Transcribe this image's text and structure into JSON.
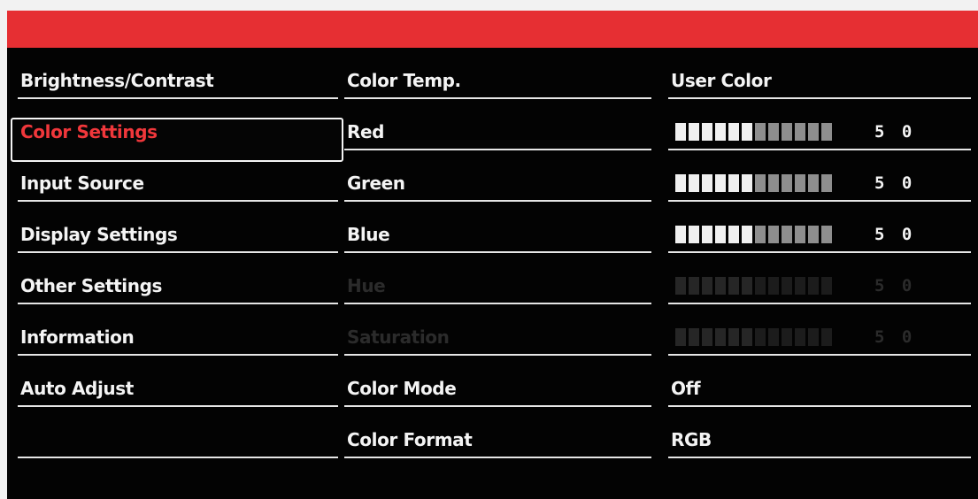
{
  "menu": {
    "items": [
      {
        "label": "Brightness/Contrast"
      },
      {
        "label": "Color Settings",
        "selected": true
      },
      {
        "label": "Input Source"
      },
      {
        "label": "Display Settings"
      },
      {
        "label": "Other Settings"
      },
      {
        "label": "Information"
      },
      {
        "label": "Auto Adjust"
      },
      {
        "label": ""
      }
    ]
  },
  "settings": {
    "rows": [
      {
        "label": "Color Temp.",
        "value": "User Color",
        "enabled": true
      },
      {
        "label": "Red",
        "level": 50,
        "value": "5 0",
        "enabled": true
      },
      {
        "label": "Green",
        "level": 50,
        "value": "5 0",
        "enabled": true
      },
      {
        "label": "Blue",
        "level": 50,
        "value": "5 0",
        "enabled": true
      },
      {
        "label": "Hue",
        "level": 50,
        "value": "5 0",
        "enabled": false
      },
      {
        "label": "Saturation",
        "level": 50,
        "value": "5 0",
        "enabled": false
      },
      {
        "label": "Color Mode",
        "value": "Off",
        "enabled": true
      },
      {
        "label": "Color Format",
        "value": "RGB",
        "enabled": true
      }
    ]
  },
  "colors": {
    "header": "#e62f33",
    "background": "#030303",
    "selected_text": "#f0373b",
    "text": "#f4f4f4",
    "disabled_text": "#2b2b2b"
  }
}
